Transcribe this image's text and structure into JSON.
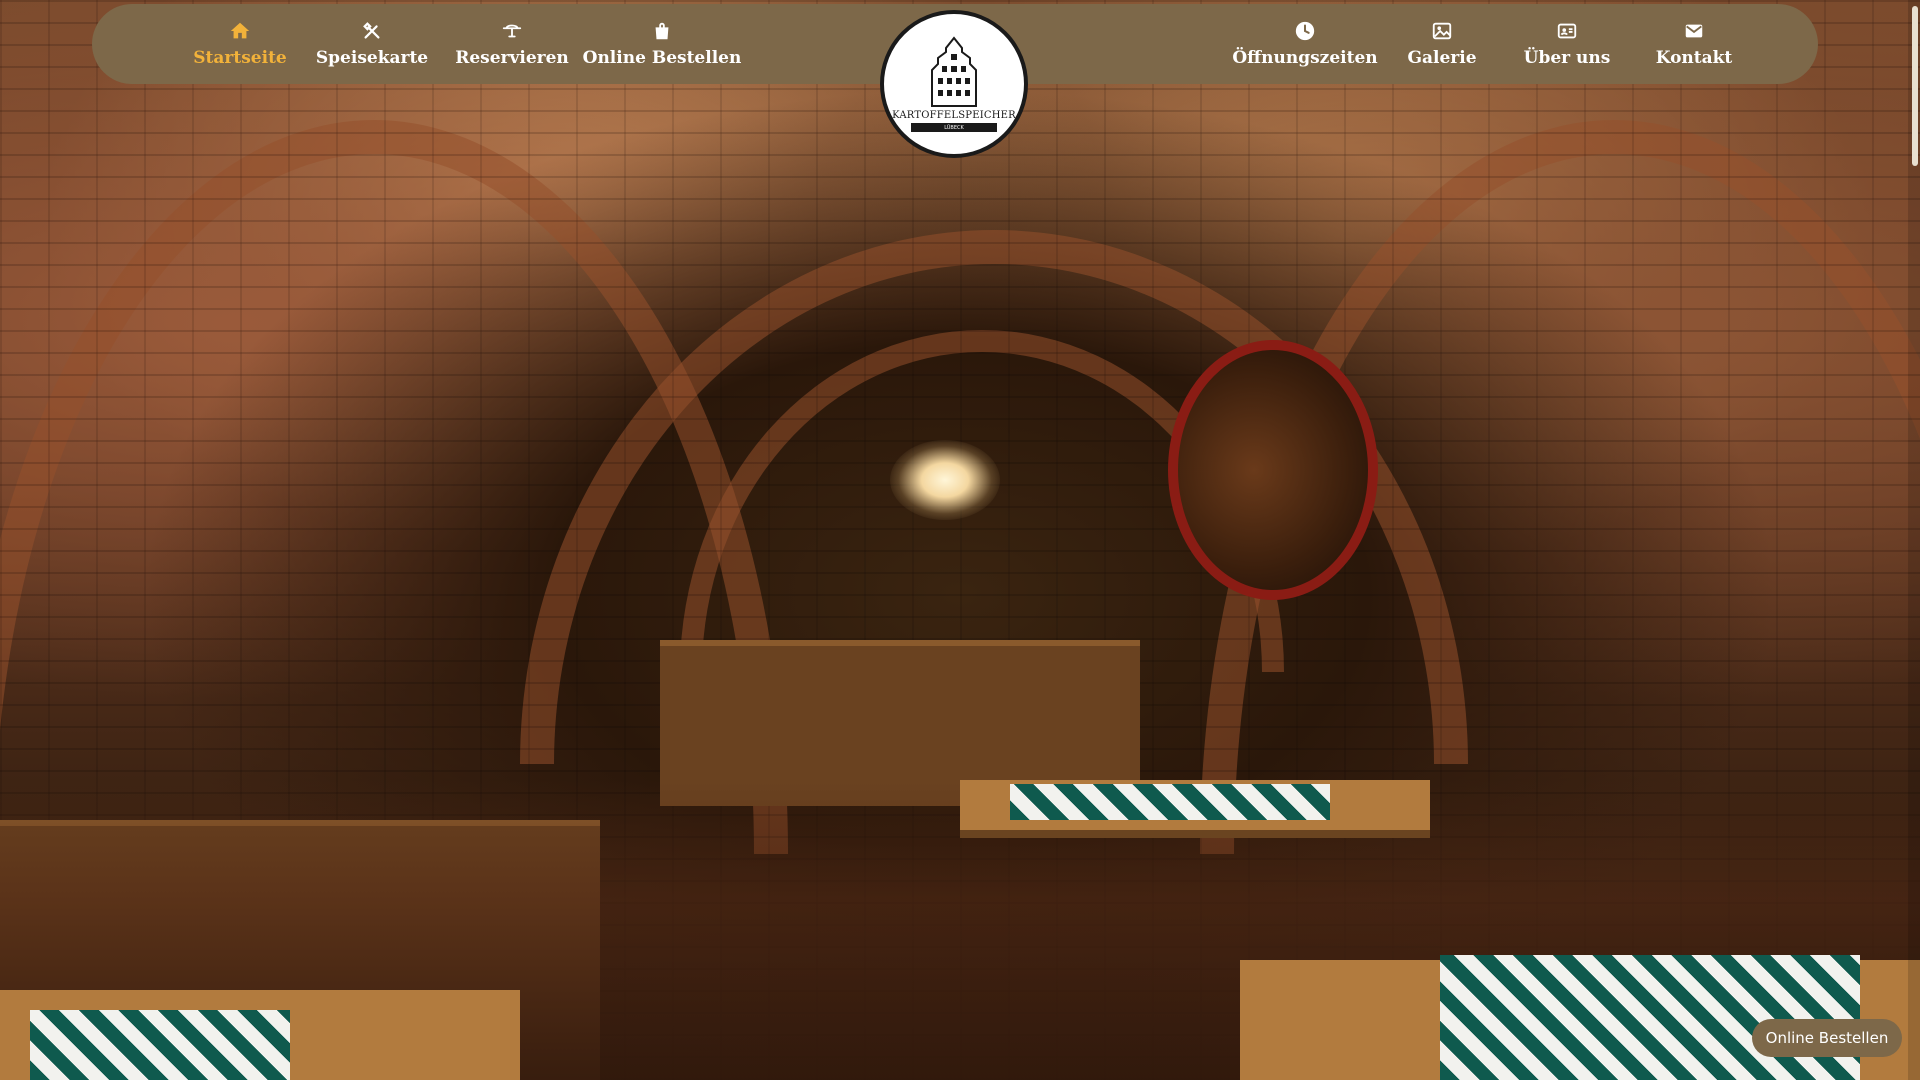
{
  "nav": {
    "left_items": [
      {
        "label": "Startseite",
        "icon": "home-icon",
        "active": true
      },
      {
        "label": "Speisekarte",
        "icon": "cutlery-icon",
        "active": false
      },
      {
        "label": "Reservieren",
        "icon": "reservation-bell-icon",
        "active": false
      },
      {
        "label": "Online Bestellen",
        "icon": "shopping-bag-icon",
        "active": false
      }
    ],
    "right_items": [
      {
        "label": "Öffnungszeiten",
        "icon": "clock-icon",
        "active": false
      },
      {
        "label": "Galerie",
        "icon": "image-icon",
        "active": false
      },
      {
        "label": "Über uns",
        "icon": "id-card-icon",
        "active": false
      },
      {
        "label": "Kontakt",
        "icon": "envelope-icon",
        "active": false
      }
    ],
    "colors": {
      "bar": "#7d6849",
      "text": "#ffffff",
      "active": "#f2b23a"
    }
  },
  "logo": {
    "name": "KARTOFFELSPEICHER",
    "subtitle": "LÜBECK"
  },
  "hero": {
    "image": "restaurant-cellar-interior"
  },
  "fab": {
    "label": "Online Bestellen"
  }
}
